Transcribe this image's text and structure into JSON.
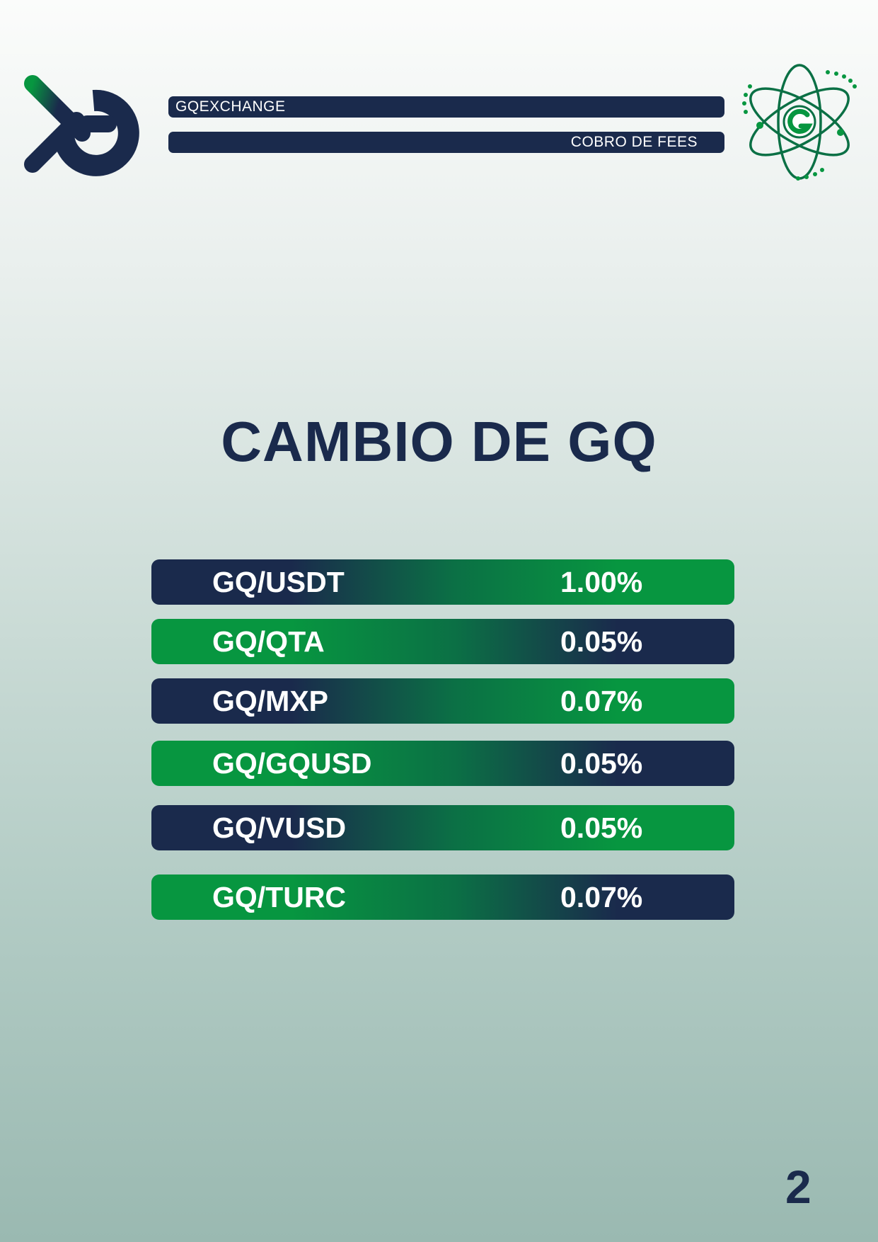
{
  "header": {
    "brand_label": "GQEXCHANGE",
    "section_label": "COBRO DE FEES"
  },
  "title": "CAMBIO DE GQ",
  "fees": [
    {
      "pair": "GQ/USDT",
      "fee": "1.00%"
    },
    {
      "pair": "GQ/QTA",
      "fee": "0.05%"
    },
    {
      "pair": "GQ/MXP",
      "fee": "0.07%"
    },
    {
      "pair": "GQ/GQUSD",
      "fee": "0.05%"
    },
    {
      "pair": "GQ/VUSD",
      "fee": "0.05%"
    },
    {
      "pair": "GQ/TURC",
      "fee": "0.07%"
    }
  ],
  "page_number": "2",
  "colors": {
    "navy": "#1a2a4c",
    "green": "#079640",
    "dark_green": "#0b7045"
  },
  "icons": {
    "left_logo": "gq-logo-icon",
    "right_logo": "gq-atom-logo-icon"
  }
}
